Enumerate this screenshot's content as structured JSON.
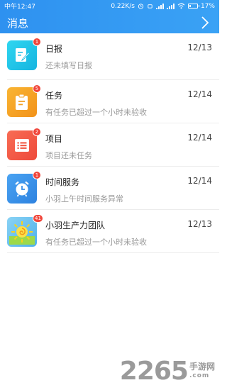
{
  "status_bar": {
    "time": "中午12:47",
    "speed": "0.22K/s",
    "battery": "17%"
  },
  "header": {
    "title": "消息",
    "action_icon": "chevron-right-icon"
  },
  "messages": [
    {
      "title": "日报",
      "date": "12/13",
      "subtitle": "还未填写日报",
      "badge": "1",
      "icon": "edit-icon",
      "color": "#1ec8e6"
    },
    {
      "title": "任务",
      "date": "12/14",
      "subtitle": "有任务已超过一个小时未验收",
      "badge": "5",
      "icon": "clipboard-icon",
      "color": "#f6a21d"
    },
    {
      "title": "项目",
      "date": "12/14",
      "subtitle": "项目还未任务",
      "badge": "2",
      "icon": "list-icon",
      "color": "#f25a47"
    },
    {
      "title": "时间服务",
      "date": "12/14",
      "subtitle": "小羽上午时间服务异常",
      "badge": "1",
      "icon": "alarm-clock-icon",
      "color": "#3a8fe8"
    },
    {
      "title": "小羽生产力团队",
      "date": "12/13",
      "subtitle": "有任务已超过一个小时未验收",
      "badge": "41",
      "icon": "sun-logo-icon",
      "color": "#6ec2f0"
    }
  ],
  "watermark": {
    "digits": "2265",
    "text": "手游网",
    "domain": ".com"
  }
}
